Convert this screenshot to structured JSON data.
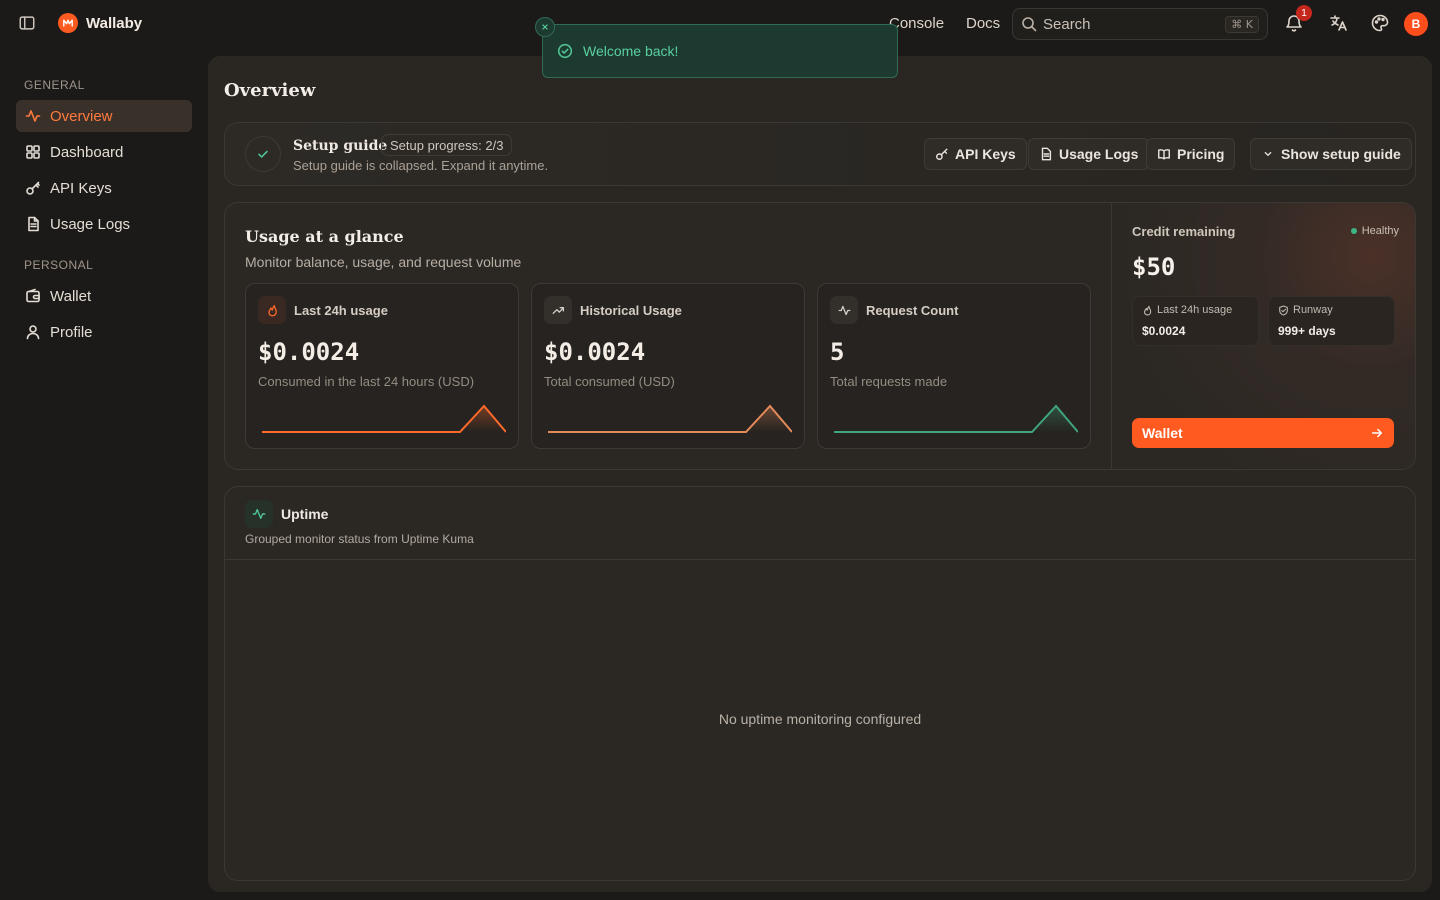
{
  "brand": {
    "name": "Wallaby"
  },
  "topbar": {
    "links": [
      "Console",
      "Docs"
    ],
    "search": {
      "placeholder": "Search",
      "shortcut": "⌘ K"
    },
    "notifications_count": "1",
    "avatar_initial": "B"
  },
  "toast": {
    "message": "Welcome back!"
  },
  "sidebar": {
    "groups": [
      {
        "label": "GENERAL",
        "items": [
          {
            "label": "Overview",
            "icon": "activity-icon",
            "active": true
          },
          {
            "label": "Dashboard",
            "icon": "dashboard-grid-icon"
          },
          {
            "label": "API Keys",
            "icon": "key-icon"
          },
          {
            "label": "Usage Logs",
            "icon": "document-icon"
          }
        ]
      },
      {
        "label": "PERSONAL",
        "items": [
          {
            "label": "Wallet",
            "icon": "wallet-icon"
          },
          {
            "label": "Profile",
            "icon": "user-icon"
          }
        ]
      }
    ]
  },
  "page": {
    "title": "Overview"
  },
  "setup_guide": {
    "title": "Setup guide",
    "progress": "Setup progress: 2/3",
    "subtitle": "Setup guide is collapsed. Expand it anytime.",
    "buttons": [
      {
        "label": "API Keys",
        "icon": "key-icon"
      },
      {
        "label": "Usage Logs",
        "icon": "document-icon"
      },
      {
        "label": "Pricing",
        "icon": "book-icon"
      },
      {
        "label": "Show setup guide",
        "icon": "chevron-down-icon"
      }
    ]
  },
  "usage": {
    "title": "Usage at a glance",
    "subtitle": "Monitor balance, usage, and request volume",
    "stats": [
      {
        "label": "Last 24h usage",
        "value": "$0.0024",
        "desc": "Consumed in the last 24 hours (USD)",
        "icon": "flame-icon",
        "accent": "#ff6a2b"
      },
      {
        "label": "Historical Usage",
        "value": "$0.0024",
        "desc": "Total consumed (USD)",
        "icon": "trending-up-icon",
        "accent": "#e58a5a"
      },
      {
        "label": "Request Count",
        "value": "5",
        "desc": "Total requests made",
        "icon": "activity-icon",
        "accent": "#3fa57c"
      }
    ]
  },
  "credit": {
    "label": "Credit remaining",
    "status": "Healthy",
    "value": "$50",
    "last24h_label": "Last 24h usage",
    "last24h_value": "$0.0024",
    "runway_label": "Runway",
    "runway_value": "999+ days",
    "wallet_button": "Wallet"
  },
  "uptime": {
    "title": "Uptime",
    "subtitle": "Grouped monitor status from Uptime Kuma",
    "empty": "No uptime monitoring configured"
  },
  "colors": {
    "accent": "#ff5a1f",
    "success": "#3fb585",
    "background": "#1c1a18",
    "panel": "#2a2723"
  }
}
